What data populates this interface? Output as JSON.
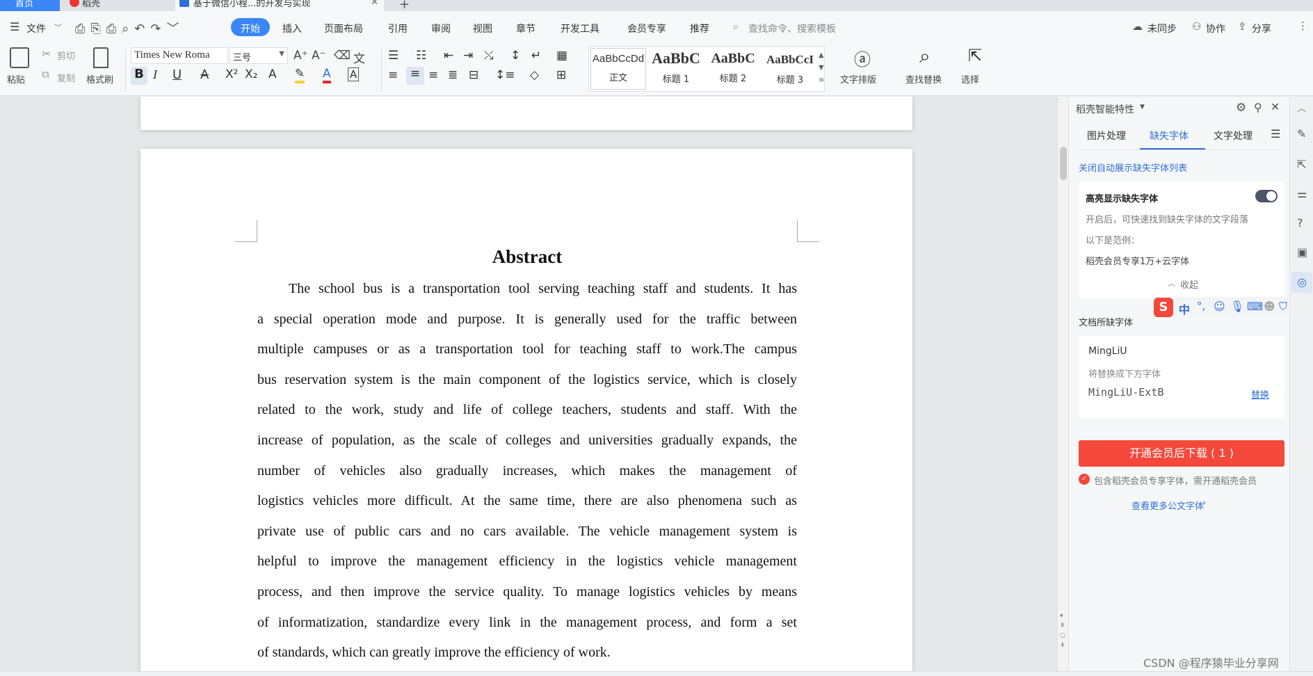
{
  "tabs": {
    "home": "首页",
    "daoke": "稻壳",
    "doc": "基于微信小程...的开发与实现"
  },
  "menu": {
    "file": "文件",
    "items": [
      "开始",
      "插入",
      "页面布局",
      "引用",
      "审阅",
      "视图",
      "章节",
      "开发工具",
      "会员专享",
      "推荐"
    ],
    "search_placeholder": "查找命令、搜索模板",
    "right": {
      "sync": "未同步",
      "collab": "协作",
      "share": "分享"
    }
  },
  "ribbon": {
    "paste": "粘贴",
    "cut": "剪切",
    "copy": "复制",
    "format_painter": "格式刷",
    "font_name": "Times New Roma",
    "font_size": "三号",
    "styles": [
      {
        "preview": "AaBbCcDd",
        "label": "正文"
      },
      {
        "preview": "AaBbC",
        "label": "标题 1"
      },
      {
        "preview": "AaBbC",
        "label": "标题 2"
      },
      {
        "preview": "AaBbCcI",
        "label": "标题 3"
      }
    ],
    "text_layout": "文字排版",
    "find_replace": "查找替换",
    "select": "选择"
  },
  "document": {
    "title": "Abstract",
    "lines": [
      "The school bus is a transportation tool serving teaching staff and students. It has",
      "a special operation mode and purpose. It is generally used for the traffic between",
      "multiple campuses or as a transportation tool for teaching staff to work.The campus",
      "bus reservation system is the main component of the logistics service, which is closely",
      "related to the work, study and life of college teachers, students and staff. With the",
      "increase of population, as the scale of colleges and universities gradually expands, the",
      "number of vehicles also gradually increases, which makes the management of",
      "logistics vehicles more difficult. At the same time, there are also phenomena such as",
      "private use of public cars and no cars available. The vehicle management system is",
      "helpful to improve the management efficiency in the logistics vehicle management",
      "process, and then improve the service quality. To manage logistics vehicles by means",
      "of informatization, standardize every link in the management process, and form a set",
      "of standards, which can greatly improve the efficiency of work."
    ]
  },
  "panel": {
    "title": "稻壳智能特性",
    "tabs": [
      "图片处理",
      "缺失字体",
      "文字处理"
    ],
    "active_tab": "缺失字体",
    "close_auto_link": "关闭自动展示缺失字体列表",
    "highlight_card": {
      "title": "高亮显示缺失字体",
      "desc": "开启后，可快速找到缺失字体的文字段落",
      "example_label": "以下是范例：",
      "example": "稻壳会员专享1万+云字体",
      "collapse": "收起"
    },
    "missing_section_title": "文档所缺字体",
    "missing_font": {
      "name": "MingLiU",
      "replace_hint": "将替换成下方字体",
      "replacement": "MingLiU-ExtB",
      "replace_btn": "替换"
    },
    "download_btn": "开通会员后下载 ( 1 )",
    "note": "包含稻壳会员专享字体，需开通稻壳会员",
    "more_link": "查看更多公文字体"
  },
  "ime": {
    "lang": "中"
  },
  "watermark": "CSDN @程序猿毕业分享网",
  "colors": {
    "accent": "#2f6fd6",
    "active_tab_bg": "#3a86f6",
    "download_btn": "#f4483b",
    "highlight": "#f5d33b",
    "font_color_red": "#e02b2b"
  }
}
